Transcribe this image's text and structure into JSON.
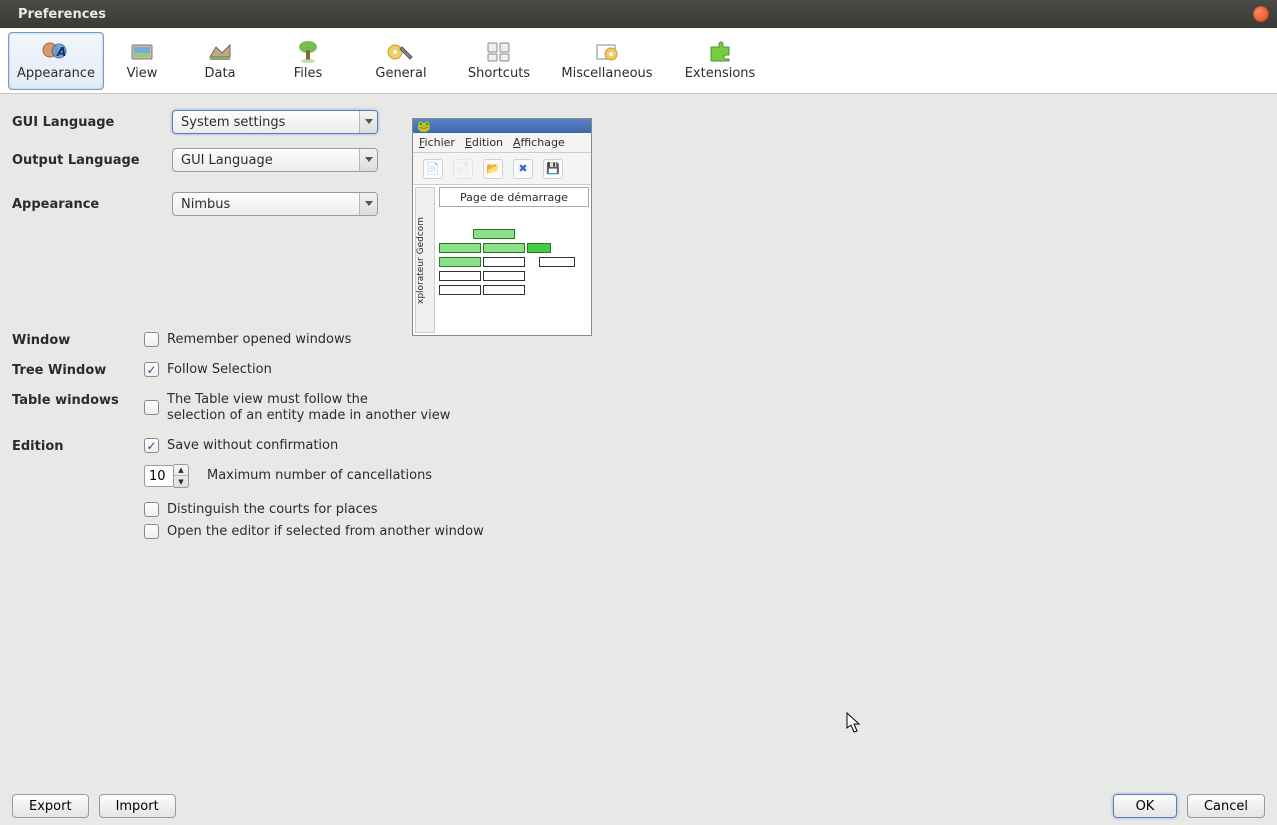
{
  "window": {
    "title": "Preferences"
  },
  "tabs": [
    {
      "id": "appearance",
      "label": "Appearance",
      "selected": true
    },
    {
      "id": "view",
      "label": "View",
      "selected": false
    },
    {
      "id": "data",
      "label": "Data",
      "selected": false
    },
    {
      "id": "files",
      "label": "Files",
      "selected": false
    },
    {
      "id": "general",
      "label": "General",
      "selected": false
    },
    {
      "id": "shortcuts",
      "label": "Shortcuts",
      "selected": false
    },
    {
      "id": "miscellaneous",
      "label": "Miscellaneous",
      "selected": false
    },
    {
      "id": "extensions",
      "label": "Extensions",
      "selected": false
    }
  ],
  "form": {
    "gui_language_label": "GUI Language",
    "gui_language_value": "System settings",
    "output_language_label": "Output Language",
    "output_language_value": "GUI Language",
    "appearance_label": "Appearance",
    "appearance_value": "Nimbus"
  },
  "preview": {
    "menu": {
      "file": "Fichier",
      "edit": "Edition",
      "view": "Affichage"
    },
    "sidebar_label": "xplorateur Gedcom",
    "tab_label": "Page de démarrage"
  },
  "sections": {
    "window": {
      "label": "Window",
      "remember_windows": {
        "checked": false,
        "text": "Remember opened windows"
      }
    },
    "tree_window": {
      "label": "Tree Window",
      "follow_selection": {
        "checked": true,
        "text": "Follow Selection"
      }
    },
    "table_windows": {
      "label": "Table windows",
      "table_follow": {
        "checked": false,
        "text": "The Table view must follow the\nselection of an entity made in another view"
      }
    },
    "edition": {
      "label": "Edition",
      "save_without_confirm": {
        "checked": true,
        "text": "Save without confirmation"
      },
      "max_cancel_value": "10",
      "max_cancel_label": "Maximum number of cancellations",
      "distinguish_courts": {
        "checked": false,
        "text": "Distinguish the courts for places"
      },
      "open_editor": {
        "checked": false,
        "text": "Open the editor if selected from another window"
      }
    }
  },
  "footer": {
    "export": "Export",
    "import": "Import",
    "ok": "OK",
    "cancel": "Cancel"
  }
}
